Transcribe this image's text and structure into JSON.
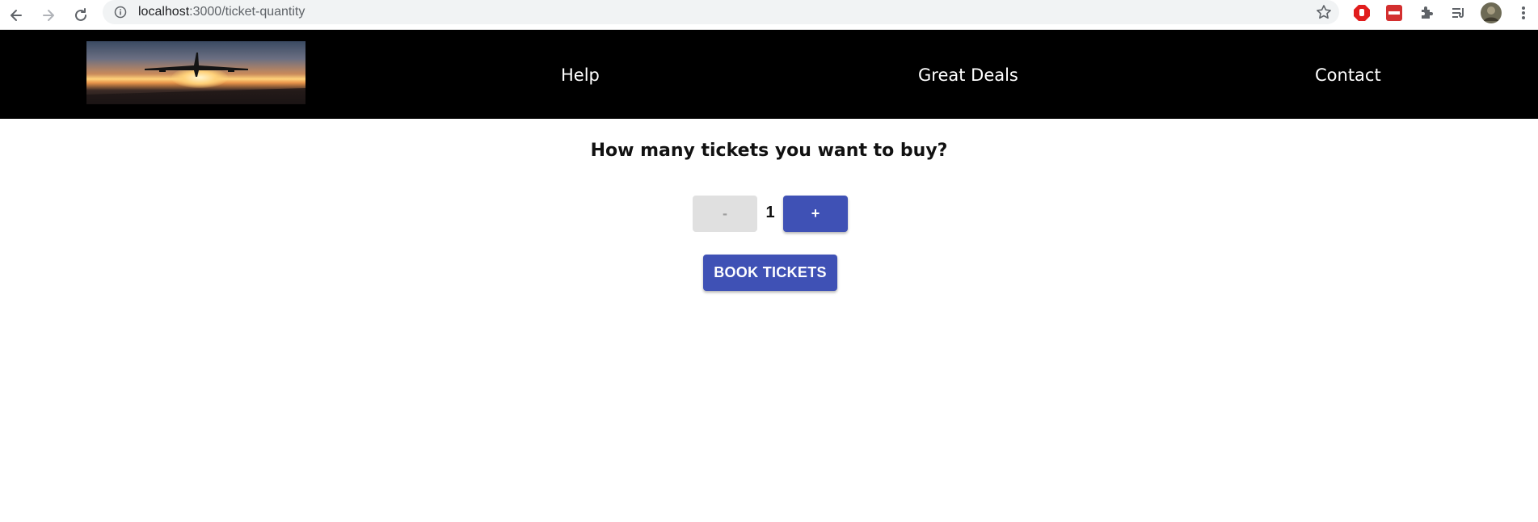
{
  "browser": {
    "url_host": "localhost",
    "url_path": ":3000/ticket-quantity"
  },
  "header": {
    "logo_alt": "airplane-at-sunset-logo",
    "nav": [
      {
        "label": "Help"
      },
      {
        "label": "Great Deals"
      },
      {
        "label": "Contact"
      }
    ]
  },
  "main": {
    "title": "How many tickets you want to buy?",
    "decrement_label": "-",
    "quantity": "1",
    "increment_label": "+",
    "book_label": "BOOK TICKETS"
  },
  "colors": {
    "header_bg": "#000000",
    "primary": "#3f51b5",
    "disabled_bg": "#e0e0e0"
  }
}
